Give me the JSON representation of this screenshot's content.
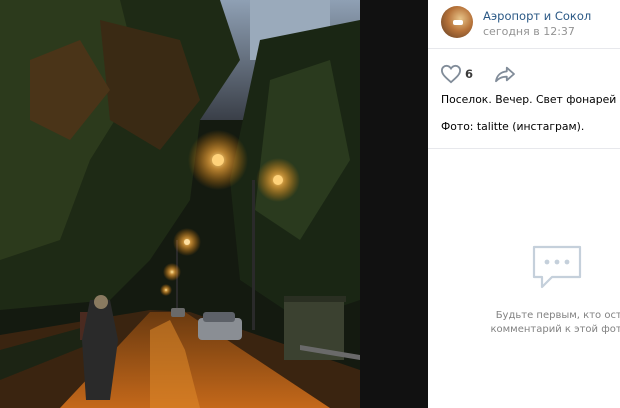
{
  "post": {
    "group_name": "Аэропорт и Сокол",
    "time": "сегодня в 12:37",
    "likes": "6",
    "text": "Поселок. Вечер. Свет фонарей",
    "credit": "Фото: talitte (инстаграм)."
  },
  "comments": {
    "empty_line1": "Будьте первым, кто остави",
    "empty_line2": "комментарий к этой фотогра"
  },
  "icons": {
    "like": "heart-icon",
    "share": "share-arrow-icon",
    "bulb": "light-bulb-icon",
    "comment": "comment-bubble-icon"
  },
  "colors": {
    "link": "#2a5885",
    "muted": "#939393",
    "lamp": "#ffb347"
  }
}
